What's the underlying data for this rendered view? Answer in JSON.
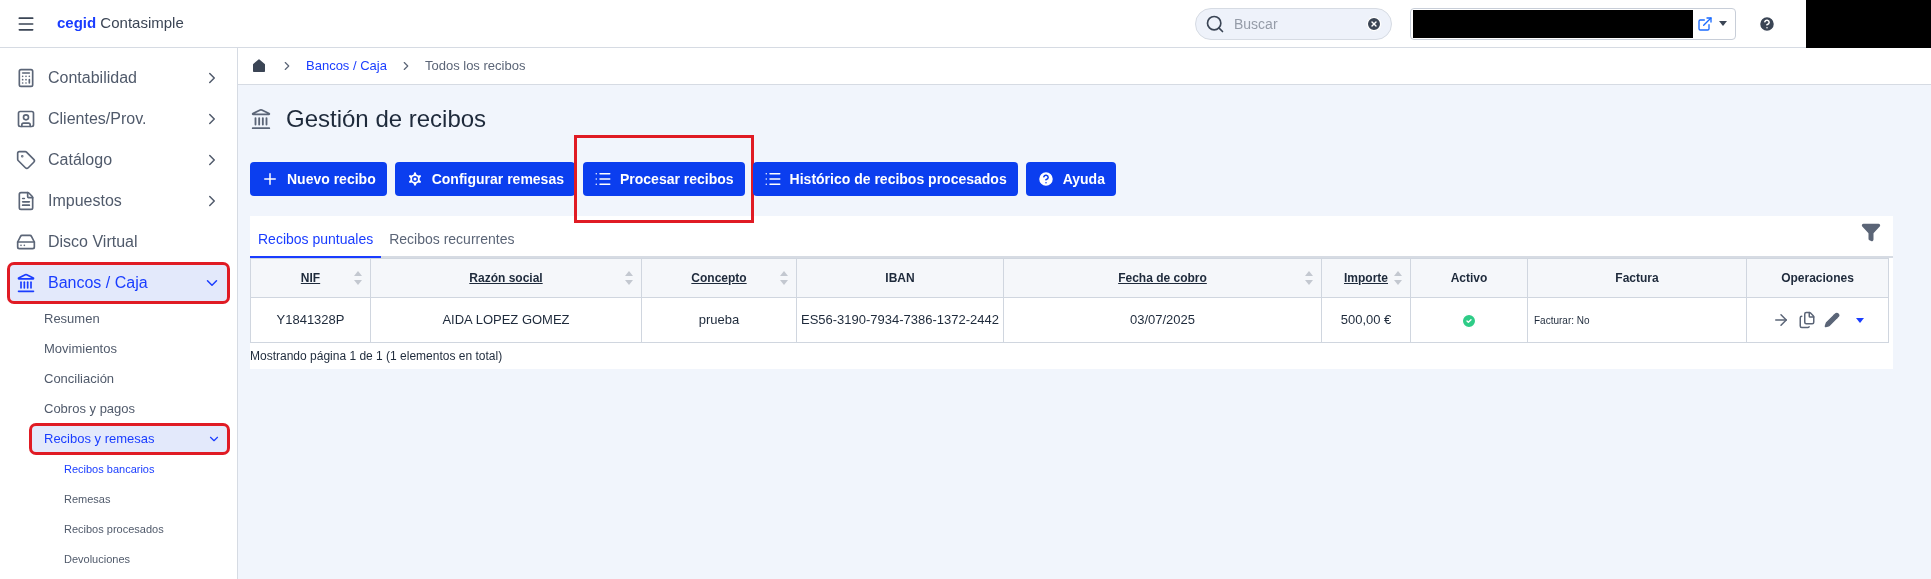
{
  "header": {
    "logo_brand": "cegid",
    "logo_product": "Contasimple",
    "search": {
      "placeholder": "Buscar"
    }
  },
  "sidebar": {
    "items": [
      {
        "label": "Contabilidad",
        "expandable": true,
        "expanded": false,
        "selected": false,
        "highlighted": false
      },
      {
        "label": "Clientes/Prov.",
        "expandable": true,
        "expanded": false,
        "selected": false,
        "highlighted": false
      },
      {
        "label": "Catálogo",
        "expandable": true,
        "expanded": false,
        "selected": false,
        "highlighted": false
      },
      {
        "label": "Impuestos",
        "expandable": true,
        "expanded": false,
        "selected": false,
        "highlighted": false
      },
      {
        "label": "Disco Virtual",
        "expandable": false,
        "selected": false,
        "highlighted": false
      },
      {
        "label": "Bancos / Caja",
        "expandable": true,
        "expanded": true,
        "selected": true,
        "highlighted": true,
        "children": [
          {
            "label": "Resumen",
            "selected": false,
            "highlighted": false
          },
          {
            "label": "Movimientos",
            "selected": false,
            "highlighted": false
          },
          {
            "label": "Conciliación",
            "selected": false,
            "highlighted": false
          },
          {
            "label": "Cobros y pagos",
            "selected": false,
            "highlighted": false
          },
          {
            "label": "Recibos y remesas",
            "selected": true,
            "expanded": true,
            "highlighted": true,
            "children": [
              {
                "label": "Recibos bancarios",
                "selected": true
              },
              {
                "label": "Remesas",
                "selected": false
              },
              {
                "label": "Recibos procesados",
                "selected": false
              },
              {
                "label": "Devoluciones",
                "selected": false
              }
            ]
          }
        ]
      }
    ]
  },
  "breadcrumb": [
    "Bancos / Caja",
    "Todos los recibos"
  ],
  "page_title": "Gestión de recibos",
  "actions": [
    {
      "label": "Nuevo recibo",
      "highlighted": false
    },
    {
      "label": "Configurar remesas",
      "highlighted": false
    },
    {
      "label": "Procesar recibos",
      "highlighted": true
    },
    {
      "label": "Histórico de recibos procesados",
      "highlighted": false
    },
    {
      "label": "Ayuda",
      "highlighted": false
    }
  ],
  "tabs": [
    {
      "label": "Recibos puntuales",
      "selected": true
    },
    {
      "label": "Recibos recurrentes",
      "selected": false
    }
  ],
  "table": {
    "columns": [
      {
        "label": "NIF",
        "sortable": true
      },
      {
        "label": "Razón social",
        "sortable": true
      },
      {
        "label": "Concepto",
        "sortable": true
      },
      {
        "label": "IBAN",
        "sortable": false
      },
      {
        "label": "Fecha de cobro",
        "sortable": true
      },
      {
        "label": "Importe",
        "sortable": true
      },
      {
        "label": "Activo",
        "sortable": false
      },
      {
        "label": "Factura",
        "sortable": false
      },
      {
        "label": "Operaciones",
        "sortable": false
      }
    ],
    "rows": [
      {
        "nif": "Y1841328P",
        "razon_social": "AIDA LOPEZ GOMEZ",
        "concepto": "prueba",
        "iban": "ES56-3190-7934-7386-1372-2442",
        "fecha_de_cobro": "03/07/2025",
        "importe": "500,00 €",
        "activo": true,
        "factura": "Facturar: No"
      }
    ]
  },
  "pagination": "Mostrando página 1 de 1 (1 elementos en total)"
}
